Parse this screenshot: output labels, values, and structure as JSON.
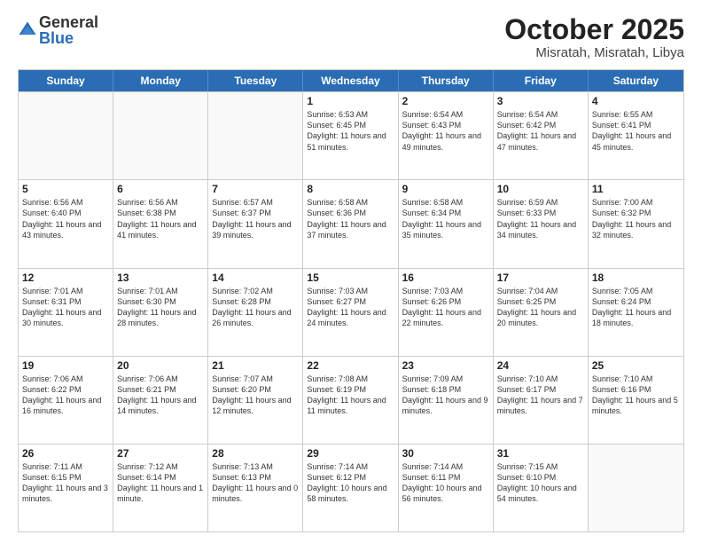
{
  "logo": {
    "general": "General",
    "blue": "Blue"
  },
  "title": "October 2025",
  "location": "Misratah, Misratah, Libya",
  "header_days": [
    "Sunday",
    "Monday",
    "Tuesday",
    "Wednesday",
    "Thursday",
    "Friday",
    "Saturday"
  ],
  "rows": [
    [
      {
        "day": "",
        "sunrise": "",
        "sunset": "",
        "daylight": "",
        "empty": true
      },
      {
        "day": "",
        "sunrise": "",
        "sunset": "",
        "daylight": "",
        "empty": true
      },
      {
        "day": "",
        "sunrise": "",
        "sunset": "",
        "daylight": "",
        "empty": true
      },
      {
        "day": "1",
        "sunrise": "Sunrise: 6:53 AM",
        "sunset": "Sunset: 6:45 PM",
        "daylight": "Daylight: 11 hours and 51 minutes."
      },
      {
        "day": "2",
        "sunrise": "Sunrise: 6:54 AM",
        "sunset": "Sunset: 6:43 PM",
        "daylight": "Daylight: 11 hours and 49 minutes."
      },
      {
        "day": "3",
        "sunrise": "Sunrise: 6:54 AM",
        "sunset": "Sunset: 6:42 PM",
        "daylight": "Daylight: 11 hours and 47 minutes."
      },
      {
        "day": "4",
        "sunrise": "Sunrise: 6:55 AM",
        "sunset": "Sunset: 6:41 PM",
        "daylight": "Daylight: 11 hours and 45 minutes."
      }
    ],
    [
      {
        "day": "5",
        "sunrise": "Sunrise: 6:56 AM",
        "sunset": "Sunset: 6:40 PM",
        "daylight": "Daylight: 11 hours and 43 minutes."
      },
      {
        "day": "6",
        "sunrise": "Sunrise: 6:56 AM",
        "sunset": "Sunset: 6:38 PM",
        "daylight": "Daylight: 11 hours and 41 minutes."
      },
      {
        "day": "7",
        "sunrise": "Sunrise: 6:57 AM",
        "sunset": "Sunset: 6:37 PM",
        "daylight": "Daylight: 11 hours and 39 minutes."
      },
      {
        "day": "8",
        "sunrise": "Sunrise: 6:58 AM",
        "sunset": "Sunset: 6:36 PM",
        "daylight": "Daylight: 11 hours and 37 minutes."
      },
      {
        "day": "9",
        "sunrise": "Sunrise: 6:58 AM",
        "sunset": "Sunset: 6:34 PM",
        "daylight": "Daylight: 11 hours and 35 minutes."
      },
      {
        "day": "10",
        "sunrise": "Sunrise: 6:59 AM",
        "sunset": "Sunset: 6:33 PM",
        "daylight": "Daylight: 11 hours and 34 minutes."
      },
      {
        "day": "11",
        "sunrise": "Sunrise: 7:00 AM",
        "sunset": "Sunset: 6:32 PM",
        "daylight": "Daylight: 11 hours and 32 minutes."
      }
    ],
    [
      {
        "day": "12",
        "sunrise": "Sunrise: 7:01 AM",
        "sunset": "Sunset: 6:31 PM",
        "daylight": "Daylight: 11 hours and 30 minutes."
      },
      {
        "day": "13",
        "sunrise": "Sunrise: 7:01 AM",
        "sunset": "Sunset: 6:30 PM",
        "daylight": "Daylight: 11 hours and 28 minutes."
      },
      {
        "day": "14",
        "sunrise": "Sunrise: 7:02 AM",
        "sunset": "Sunset: 6:28 PM",
        "daylight": "Daylight: 11 hours and 26 minutes."
      },
      {
        "day": "15",
        "sunrise": "Sunrise: 7:03 AM",
        "sunset": "Sunset: 6:27 PM",
        "daylight": "Daylight: 11 hours and 24 minutes."
      },
      {
        "day": "16",
        "sunrise": "Sunrise: 7:03 AM",
        "sunset": "Sunset: 6:26 PM",
        "daylight": "Daylight: 11 hours and 22 minutes."
      },
      {
        "day": "17",
        "sunrise": "Sunrise: 7:04 AM",
        "sunset": "Sunset: 6:25 PM",
        "daylight": "Daylight: 11 hours and 20 minutes."
      },
      {
        "day": "18",
        "sunrise": "Sunrise: 7:05 AM",
        "sunset": "Sunset: 6:24 PM",
        "daylight": "Daylight: 11 hours and 18 minutes."
      }
    ],
    [
      {
        "day": "19",
        "sunrise": "Sunrise: 7:06 AM",
        "sunset": "Sunset: 6:22 PM",
        "daylight": "Daylight: 11 hours and 16 minutes."
      },
      {
        "day": "20",
        "sunrise": "Sunrise: 7:06 AM",
        "sunset": "Sunset: 6:21 PM",
        "daylight": "Daylight: 11 hours and 14 minutes."
      },
      {
        "day": "21",
        "sunrise": "Sunrise: 7:07 AM",
        "sunset": "Sunset: 6:20 PM",
        "daylight": "Daylight: 11 hours and 12 minutes."
      },
      {
        "day": "22",
        "sunrise": "Sunrise: 7:08 AM",
        "sunset": "Sunset: 6:19 PM",
        "daylight": "Daylight: 11 hours and 11 minutes."
      },
      {
        "day": "23",
        "sunrise": "Sunrise: 7:09 AM",
        "sunset": "Sunset: 6:18 PM",
        "daylight": "Daylight: 11 hours and 9 minutes."
      },
      {
        "day": "24",
        "sunrise": "Sunrise: 7:10 AM",
        "sunset": "Sunset: 6:17 PM",
        "daylight": "Daylight: 11 hours and 7 minutes."
      },
      {
        "day": "25",
        "sunrise": "Sunrise: 7:10 AM",
        "sunset": "Sunset: 6:16 PM",
        "daylight": "Daylight: 11 hours and 5 minutes."
      }
    ],
    [
      {
        "day": "26",
        "sunrise": "Sunrise: 7:11 AM",
        "sunset": "Sunset: 6:15 PM",
        "daylight": "Daylight: 11 hours and 3 minutes."
      },
      {
        "day": "27",
        "sunrise": "Sunrise: 7:12 AM",
        "sunset": "Sunset: 6:14 PM",
        "daylight": "Daylight: 11 hours and 1 minute."
      },
      {
        "day": "28",
        "sunrise": "Sunrise: 7:13 AM",
        "sunset": "Sunset: 6:13 PM",
        "daylight": "Daylight: 11 hours and 0 minutes."
      },
      {
        "day": "29",
        "sunrise": "Sunrise: 7:14 AM",
        "sunset": "Sunset: 6:12 PM",
        "daylight": "Daylight: 10 hours and 58 minutes."
      },
      {
        "day": "30",
        "sunrise": "Sunrise: 7:14 AM",
        "sunset": "Sunset: 6:11 PM",
        "daylight": "Daylight: 10 hours and 56 minutes."
      },
      {
        "day": "31",
        "sunrise": "Sunrise: 7:15 AM",
        "sunset": "Sunset: 6:10 PM",
        "daylight": "Daylight: 10 hours and 54 minutes."
      },
      {
        "day": "",
        "sunrise": "",
        "sunset": "",
        "daylight": "",
        "empty": true
      }
    ]
  ]
}
